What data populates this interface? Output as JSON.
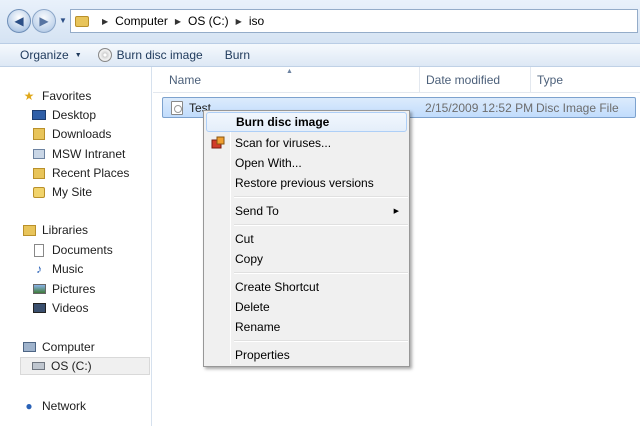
{
  "address": {
    "crumbs": [
      "Computer",
      "OS (C:)",
      "iso"
    ]
  },
  "toolbar": {
    "organize": "Organize",
    "burn_disc_image": "Burn disc image",
    "burn": "Burn"
  },
  "nav": {
    "favorites": "Favorites",
    "desktop": "Desktop",
    "downloads": "Downloads",
    "msw_intranet": "MSW Intranet",
    "recent_places": "Recent Places",
    "my_site": "My Site",
    "libraries": "Libraries",
    "documents": "Documents",
    "music": "Music",
    "pictures": "Pictures",
    "videos": "Videos",
    "computer": "Computer",
    "os_c": "OS (C:)",
    "network": "Network"
  },
  "columns": {
    "name": "Name",
    "date_modified": "Date modified",
    "type": "Type"
  },
  "file": {
    "name": "Test",
    "date": "2/15/2009 12:52 PM",
    "type": "Disc Image File"
  },
  "context_menu": {
    "burn_disc_image": "Burn disc image",
    "scan_for_viruses": "Scan for viruses...",
    "open_with": "Open With...",
    "restore_previous_versions": "Restore previous versions",
    "send_to": "Send To",
    "cut": "Cut",
    "copy": "Copy",
    "create_shortcut": "Create Shortcut",
    "delete": "Delete",
    "rename": "Rename",
    "properties": "Properties"
  },
  "colors": {
    "selection_bg": "#c1dcfc",
    "selection_border": "#7da2ce",
    "menu_bg": "#f0f0f0",
    "toolbar_text": "#1e395b"
  },
  "icons": [
    "back-icon",
    "forward-icon",
    "folder-icon",
    "disc-icon",
    "star-icon",
    "desktop-icon",
    "downloads-icon",
    "network-icon",
    "computer-icon",
    "drive-icon",
    "library-icon",
    "music-icon",
    "pictures-icon",
    "videos-icon",
    "shield-scan-icon"
  ]
}
